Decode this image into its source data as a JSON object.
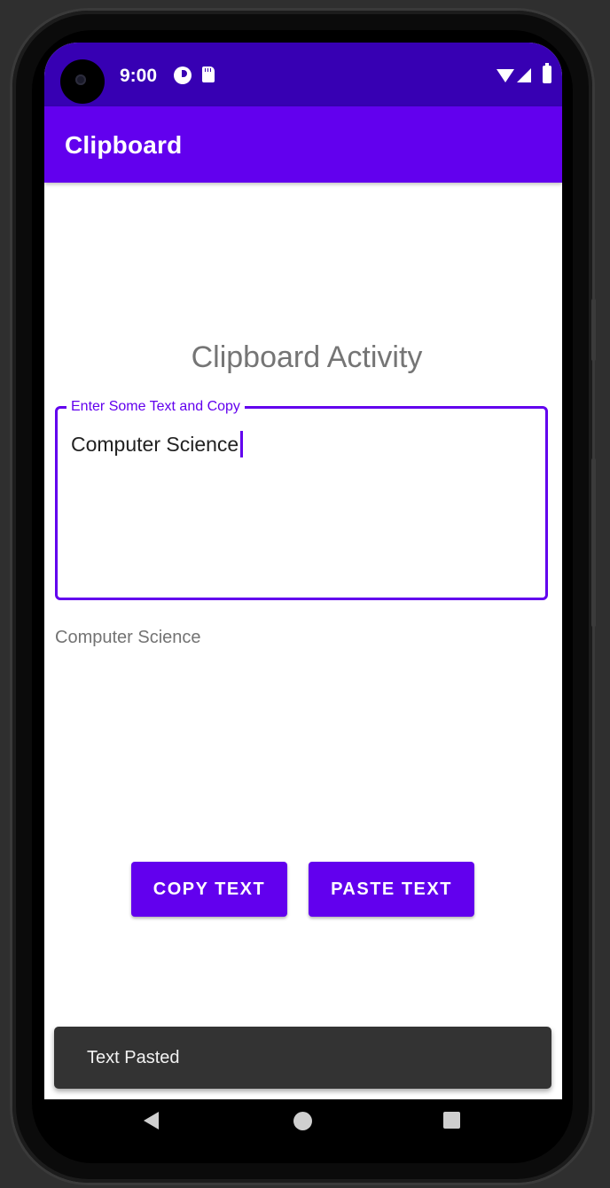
{
  "status_bar": {
    "time": "9:00",
    "icons": [
      "camera-cutout-icon",
      "notification-icon",
      "sd-card-icon",
      "wifi-icon",
      "signal-icon",
      "battery-icon"
    ]
  },
  "app_bar": {
    "title": "Clipboard",
    "color": "#6200ee"
  },
  "main": {
    "heading": "Clipboard Activity",
    "input": {
      "label": "Enter Some Text and Copy",
      "value": "Computer Science"
    },
    "pasted_text": "Computer Science",
    "buttons": {
      "copy_label": "COPY TEXT",
      "paste_label": "PASTE TEXT"
    }
  },
  "snackbar": {
    "message": "Text Pasted"
  },
  "nav_bar": {
    "icons": [
      "back-icon",
      "home-icon",
      "recents-icon"
    ]
  },
  "colors": {
    "primary": "#6200ee",
    "primary_dark": "#3700b3",
    "snackbar_bg": "#333333"
  }
}
